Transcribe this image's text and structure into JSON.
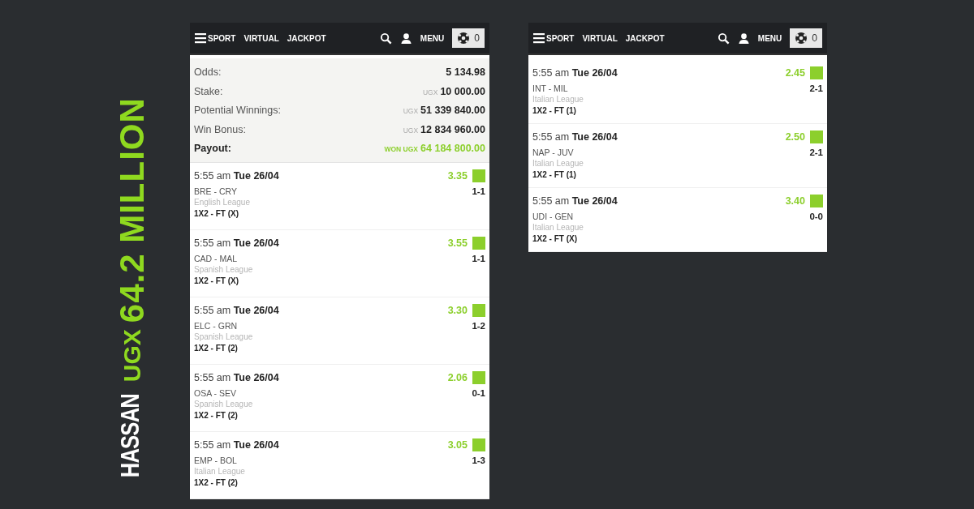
{
  "headline": {
    "name": "HASSAN",
    "prefix": "UGX",
    "amount": "64.2 MILLION"
  },
  "screens": [
    {
      "nav": {
        "items": [
          "SPORT",
          "VIRTUAL",
          "JACKPOT"
        ],
        "menu": "MENU",
        "betslip_count": "0"
      },
      "summary": [
        {
          "kind": "plain",
          "label": "Odds:",
          "value": "5 134.98"
        },
        {
          "kind": "plain",
          "label": "Stake:",
          "unit": "UGX",
          "value": "10 000.00"
        },
        {
          "kind": "plain",
          "label": "Potential Winnings:",
          "unit": "UGX",
          "value": "51 339 840.00"
        },
        {
          "kind": "plain",
          "label": "Win Bonus:",
          "unit": "UGX",
          "value": "12 834 960.00"
        },
        {
          "kind": "payout",
          "label": "Payout:",
          "unit": "WON UGX",
          "value": "64 184 800.00"
        }
      ],
      "selections": [
        {
          "time": "5:55 am",
          "date": "Tue 26/04",
          "odds": "3.35",
          "won": true,
          "match": "BRE - CRY",
          "score": "1-1",
          "league": "English League",
          "market": "1X2 - FT (X)"
        },
        {
          "time": "5:55 am",
          "date": "Tue 26/04",
          "odds": "3.55",
          "won": true,
          "match": "CAD - MAL",
          "score": "1-1",
          "league": "Spanish League",
          "market": "1X2 - FT (X)"
        },
        {
          "time": "5:55 am",
          "date": "Tue 26/04",
          "odds": "3.30",
          "won": true,
          "match": "ELC - GRN",
          "score": "1-2",
          "league": "Spanish League",
          "market": "1X2 - FT (2)"
        },
        {
          "time": "5:55 am",
          "date": "Tue 26/04",
          "odds": "2.06",
          "won": true,
          "match": "OSA - SEV",
          "score": "0-1",
          "league": "Spanish League",
          "market": "1X2 - FT (2)"
        },
        {
          "time": "5:55 am",
          "date": "Tue 26/04",
          "odds": "3.05",
          "won": true,
          "match": "EMP - BOL",
          "score": "1-3",
          "league": "Italian League",
          "market": "1X2 - FT (2)"
        }
      ]
    },
    {
      "nav": {
        "items": [
          "SPORT",
          "VIRTUAL",
          "JACKPOT"
        ],
        "menu": "MENU",
        "betslip_count": "0"
      },
      "selections": [
        {
          "time": "5:55 am",
          "date": "Tue 26/04",
          "odds": "2.45",
          "won": true,
          "match": "INT - MIL",
          "score": "2-1",
          "league": "Italian League",
          "market": "1X2 - FT (1)"
        },
        {
          "time": "5:55 am",
          "date": "Tue 26/04",
          "odds": "2.50",
          "won": true,
          "match": "NAP - JUV",
          "score": "2-1",
          "league": "Italian League",
          "market": "1X2 - FT (1)"
        },
        {
          "time": "5:55 am",
          "date": "Tue 26/04",
          "odds": "3.40",
          "won": true,
          "match": "UDI - GEN",
          "score": "0-0",
          "league": "Italian League",
          "market": "1X2 - FT (X)"
        }
      ]
    }
  ]
}
